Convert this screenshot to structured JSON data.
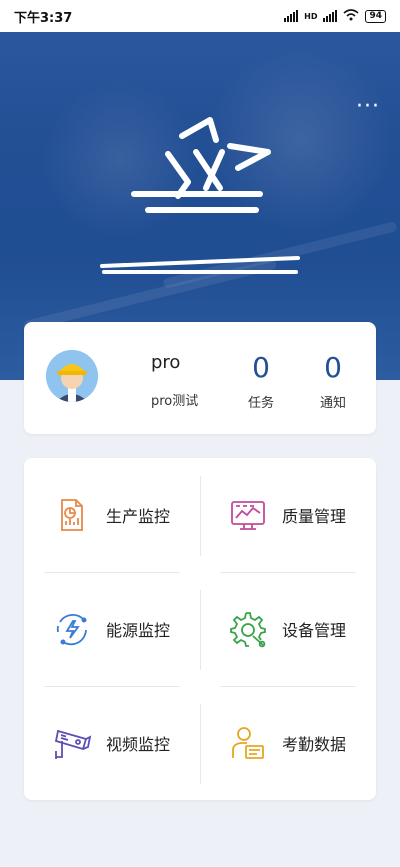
{
  "status_bar": {
    "time": "下午3:37",
    "network_label": "HD",
    "battery": "94"
  },
  "header": {
    "more_icon": "more-dots-icon",
    "logo_caption": "",
    "brand_color": "#234f95"
  },
  "profile": {
    "name": "pro",
    "subtitle": "pro测试",
    "stats": {
      "tasks": {
        "value": "0",
        "label": "任务"
      },
      "notifications": {
        "value": "0",
        "label": "通知"
      }
    }
  },
  "menu": [
    {
      "label": "生产监控",
      "icon": "production-monitor-icon",
      "color": "#e8894a"
    },
    {
      "label": "质量管理",
      "icon": "quality-management-icon",
      "color": "#c04b9c"
    },
    {
      "label": "能源监控",
      "icon": "energy-monitor-icon",
      "color": "#3a7bd5"
    },
    {
      "label": "设备管理",
      "icon": "device-management-icon",
      "color": "#3aa34a"
    },
    {
      "label": "视频监控",
      "icon": "video-monitor-icon",
      "color": "#5b4fb5"
    },
    {
      "label": "考勤数据",
      "icon": "attendance-data-icon",
      "color": "#e6a623"
    }
  ]
}
